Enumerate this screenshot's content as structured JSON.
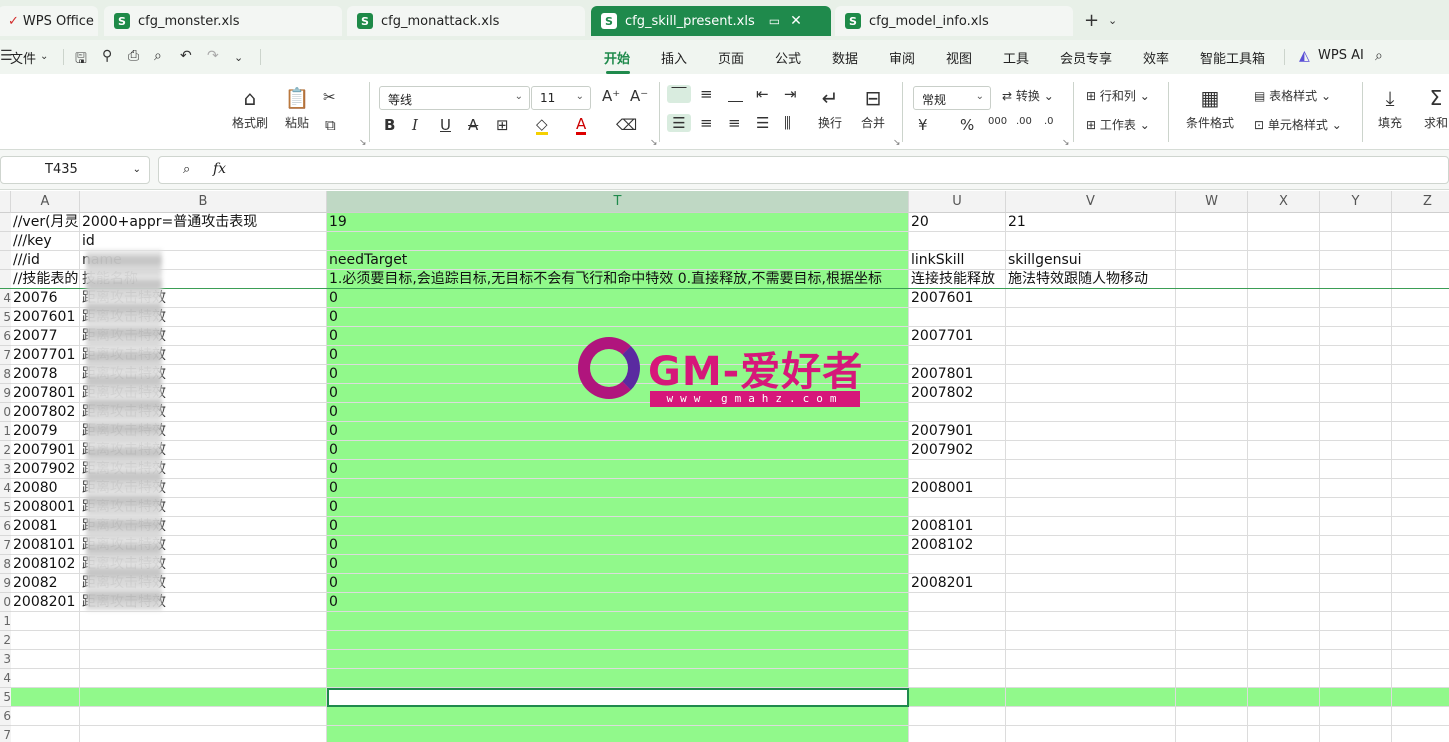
{
  "tabs": [
    {
      "label": "WPS Office"
    },
    {
      "label": "cfg_monster.xls"
    },
    {
      "label": "cfg_monattack.xls"
    },
    {
      "label": "cfg_skill_present.xls"
    },
    {
      "label": "cfg_model_info.xls"
    }
  ],
  "file_menu": "文件",
  "menu": [
    "开始",
    "插入",
    "页面",
    "公式",
    "数据",
    "审阅",
    "视图",
    "工具",
    "会员专享",
    "效率",
    "智能工具箱"
  ],
  "wps_ai": "WPS AI",
  "ribbon": {
    "format_painter": "格式刷",
    "paste": "粘贴",
    "font": "等线",
    "font_size": "11",
    "wrap": "换行",
    "merge": "合并",
    "number_format": "常规",
    "convert": "转换",
    "rows_cols": "行和列",
    "worksheet": "工作表",
    "cond_format": "条件格式",
    "table_style": "表格样式",
    "cell_style": "单元格样式",
    "fill": "填充",
    "sum": "求和"
  },
  "namebox": "T435",
  "col_headers": [
    "A",
    "B",
    "T",
    "U",
    "V",
    "W",
    "X",
    "Y",
    "Z"
  ],
  "row_headers": [
    "",
    "",
    "",
    "",
    "4",
    "5",
    "6",
    "7",
    "8",
    "9",
    "0",
    "1",
    "2",
    "3",
    "4",
    "5",
    "6",
    "7",
    "8",
    "9",
    "0",
    "1",
    "2",
    "3",
    "4",
    "5",
    "6",
    "7"
  ],
  "rows": [
    [
      "//ver(月灵",
      "2000+appr=普通攻击表现",
      "19",
      "20",
      "21"
    ],
    [
      "///key",
      "id",
      "",
      "",
      ""
    ],
    [
      "///id",
      "name",
      "needTarget",
      "linkSkill",
      "skillgensui"
    ],
    [
      "//技能表的",
      "技能名称",
      "1.必须要目标,会追踪目标,无目标不会有飞行和命中特效 0.直接释放,不需要目标,根据坐标",
      "连接技能释放",
      "施法特效跟随人物移动"
    ],
    [
      "20076",
      "距离攻击特效",
      "0",
      "2007601",
      ""
    ],
    [
      "2007601",
      "距离攻击特效",
      "0",
      "",
      ""
    ],
    [
      "20077",
      "距离攻击特效",
      "0",
      "2007701",
      ""
    ],
    [
      "2007701",
      "距离攻击特效",
      "0",
      "",
      ""
    ],
    [
      "20078",
      "距离攻击特效",
      "0",
      "2007801",
      ""
    ],
    [
      "2007801",
      "距离攻击特效",
      "0",
      "2007802",
      ""
    ],
    [
      "2007802",
      "距离攻击特效",
      "0",
      "",
      ""
    ],
    [
      "20079",
      "距离攻击特效",
      "0",
      "2007901",
      ""
    ],
    [
      "2007901",
      "距离攻击特效",
      "0",
      "2007902",
      ""
    ],
    [
      "2007902",
      "距离攻击特效",
      "0",
      "",
      ""
    ],
    [
      "20080",
      "距离攻击特效",
      "0",
      "2008001",
      ""
    ],
    [
      "2008001",
      "距离攻击特效",
      "0",
      "",
      ""
    ],
    [
      "20081",
      "距离攻击特效",
      "0",
      "2008101",
      ""
    ],
    [
      "2008101",
      "距离攻击特效",
      "0",
      "2008102",
      ""
    ],
    [
      "2008102",
      "距离攻击特效",
      "0",
      "",
      ""
    ],
    [
      "20082",
      "距离攻击特效",
      "0",
      "2008201",
      ""
    ],
    [
      "2008201",
      "距离攻击特效",
      "0",
      "",
      ""
    ]
  ],
  "watermark": {
    "text": "GM-爱好者",
    "url": "www.gmahz.com"
  },
  "colors": {
    "accent": "#1f8a4c",
    "selection": "#91f98b"
  }
}
